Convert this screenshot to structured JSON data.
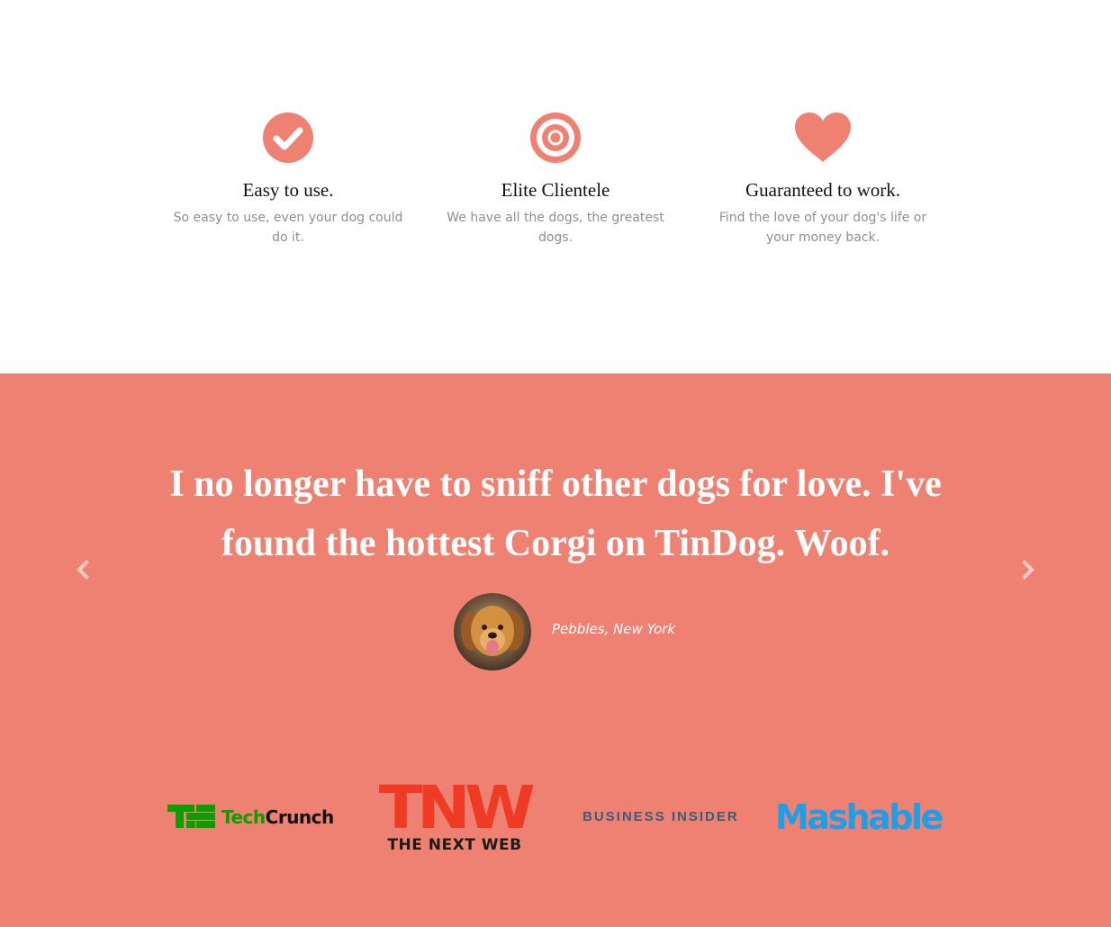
{
  "features": [
    {
      "icon": "check-circle-icon",
      "title": "Easy to use.",
      "text": "So easy to use, even your dog could do it."
    },
    {
      "icon": "bullseye-icon",
      "title": "Elite Clientele",
      "text": "We have all the dogs, the greatest dogs."
    },
    {
      "icon": "heart-icon",
      "title": "Guaranteed to work.",
      "text": "Find the love of your dog's life or your money back."
    }
  ],
  "testimonial": {
    "quote": "I no longer have to sniff other dogs for love. I've found the hottest Corgi on TinDog. Woof.",
    "author": "Pebbles, New York",
    "avatar_icon": "dog-avatar"
  },
  "press": {
    "techcrunch": {
      "tech": "Tech",
      "crunch": "Crunch"
    },
    "tnw": {
      "big": "TNW",
      "small": "THE NEXT WEB"
    },
    "business_insider": "BUSINESS INSIDER",
    "mashable": "Mashable"
  },
  "colors": {
    "accent": "#ef8172",
    "techcrunch_green": "#0a9e01",
    "tnw_red": "#ef3b24",
    "mashable_blue": "#1d9ee8"
  }
}
